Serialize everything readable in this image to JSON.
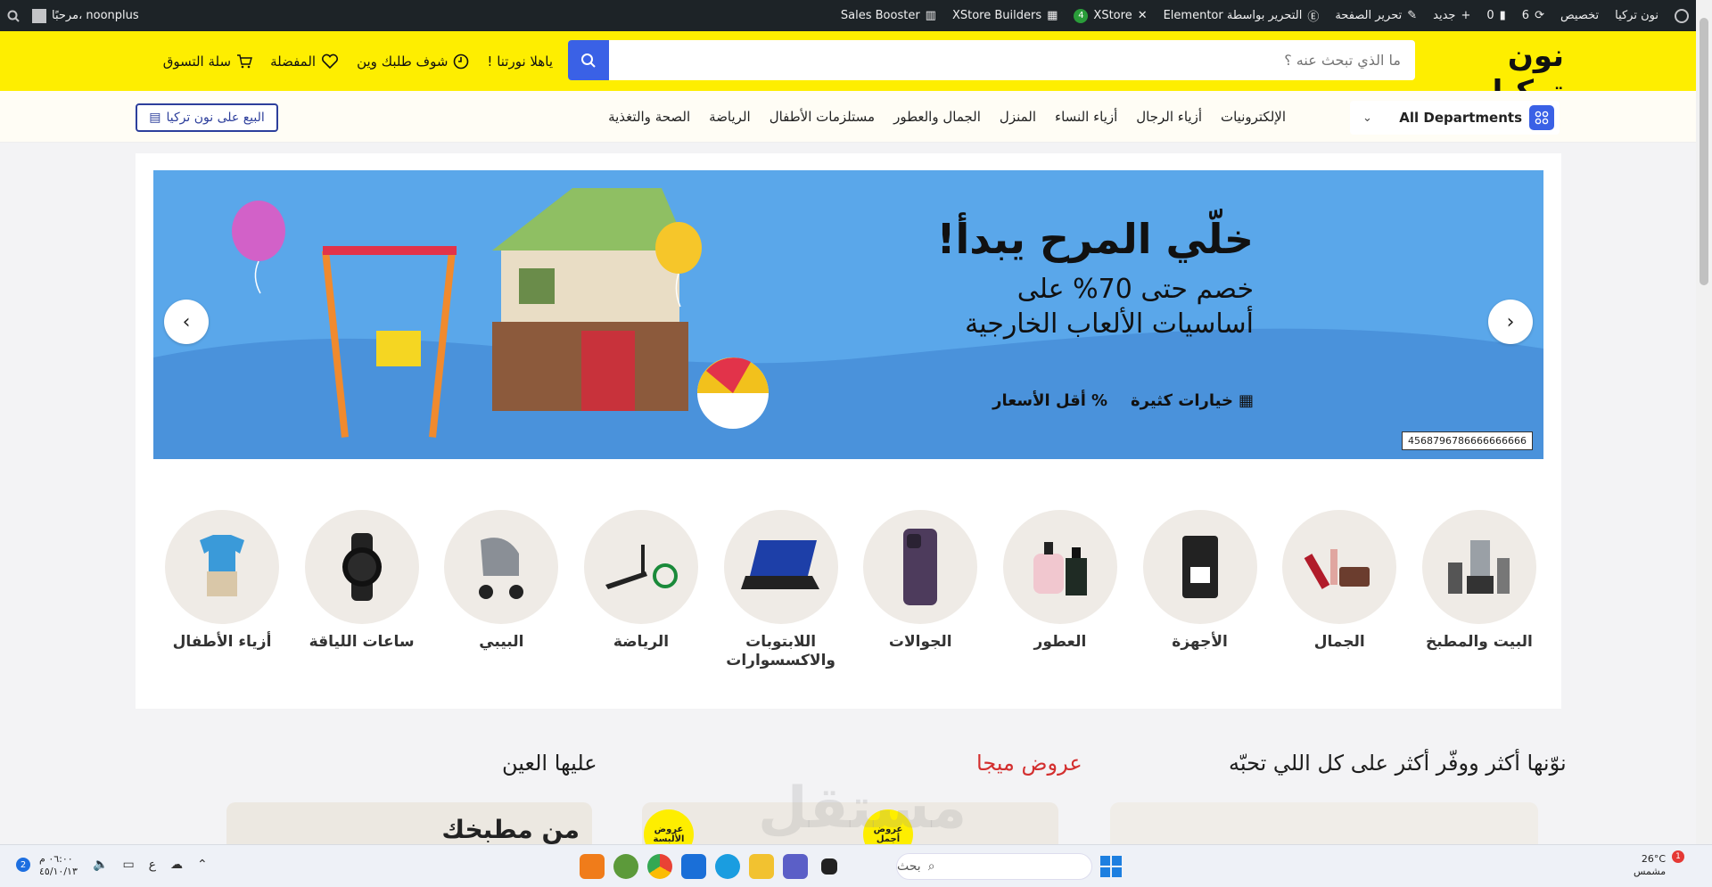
{
  "admin_bar": {
    "site": "نون تركيا",
    "customize": "تخصيص",
    "updates_count": "6",
    "comments_count": "0",
    "new": "جديد",
    "edit_page": "تحرير الصفحة",
    "elementor": "التحرير بواسطة Elementor",
    "xstore": "XStore",
    "xstore_badge": "4",
    "xstore_builders": "XStore Builders",
    "sales_booster": "Sales Booster",
    "greeting": "مرحبًا، noonplus"
  },
  "header": {
    "logo": "نون تركيا",
    "search_placeholder": "ما الذي تبحث عنه ؟",
    "welcome": "ياهلا نورتنا !",
    "track_order": "شوف طلبك وين",
    "wishlist": "المفضلة",
    "cart": "سلة التسوق"
  },
  "nav": {
    "departments": "All Departments",
    "links": [
      "الإلكترونيات",
      "أزياء الرجال",
      "أزياء النساء",
      "المنزل",
      "الجمال والعطور",
      "مستلزمات الأطفال",
      "الرياضة",
      "الصحة والتغذية"
    ],
    "sell_button": "البيع على نون تركيا"
  },
  "banner": {
    "headline": "خلّي المرح يبدأ!",
    "line1": "خصم حتى 70% على",
    "line2": "أساسيات الألعاب الخارجية",
    "feature1": "خيارات كثيرة",
    "feature2": "أقل الأسعار",
    "code": "4568796786666666666"
  },
  "categories": [
    {
      "label": "البيت والمطبخ",
      "icon": "blender-icon"
    },
    {
      "label": "الجمال",
      "icon": "makeup-icon"
    },
    {
      "label": "الأجهزة",
      "icon": "coffee-machine-icon"
    },
    {
      "label": "العطور",
      "icon": "perfume-icon"
    },
    {
      "label": "الجوالات",
      "icon": "phone-icon"
    },
    {
      "label": "اللابتوبات والاكسسوارات",
      "icon": "laptop-icon"
    },
    {
      "label": "الرياضة",
      "icon": "treadmill-icon"
    },
    {
      "label": "البيبي",
      "icon": "stroller-icon"
    },
    {
      "label": "ساعات اللياقة",
      "icon": "smartwatch-icon"
    },
    {
      "label": "أزياء الأطفال",
      "icon": "kids-clothes-icon"
    }
  ],
  "sections": {
    "main": "نوّنها أكثر ووفّر أكثر على كل اللي تحبّه",
    "mega": "عروض ميجا",
    "eye": "عليها العين",
    "kitchen": "من مطبخك",
    "badge1": "عروض الألبسة",
    "badge2": "عروض أجمل"
  },
  "watermark": "مستقل",
  "taskbar": {
    "search": "بحث",
    "temp": "26°C",
    "weather": "مشمس",
    "time": "٠٦:٠٠ م",
    "date": "٤٥/١٠/١٣",
    "lang": "ع",
    "notif": "1"
  },
  "colors": {
    "brand_yellow": "#feee00",
    "accent_blue": "#3a61e6",
    "mega_red": "#d32f2f"
  }
}
